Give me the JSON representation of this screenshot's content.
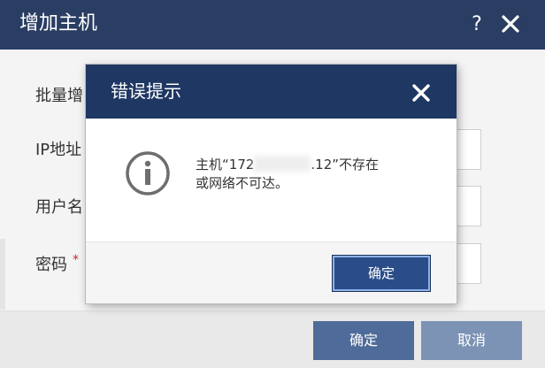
{
  "outer_dialog": {
    "title": "增加主机",
    "help_glyph": "?",
    "form_labels": {
      "batch": "批量增",
      "ip": "IP地址",
      "username": "用户名",
      "password": "密码"
    },
    "required_mark": "*",
    "buttons": {
      "confirm": "确定",
      "cancel": "取消"
    }
  },
  "error_modal": {
    "title": "错误提示",
    "icon": "info-circle-icon",
    "message_line1_prefix": "主机“172",
    "message_line1_suffix": ".12”不存在",
    "message_line2": "或网络不可达。",
    "ok_label": "确定"
  },
  "colors": {
    "header_bg": "#2a3d63",
    "modal_header_bg": "#1f3763",
    "primary_button": "#2a4d8a",
    "cancel_button": "#7d93b5"
  }
}
